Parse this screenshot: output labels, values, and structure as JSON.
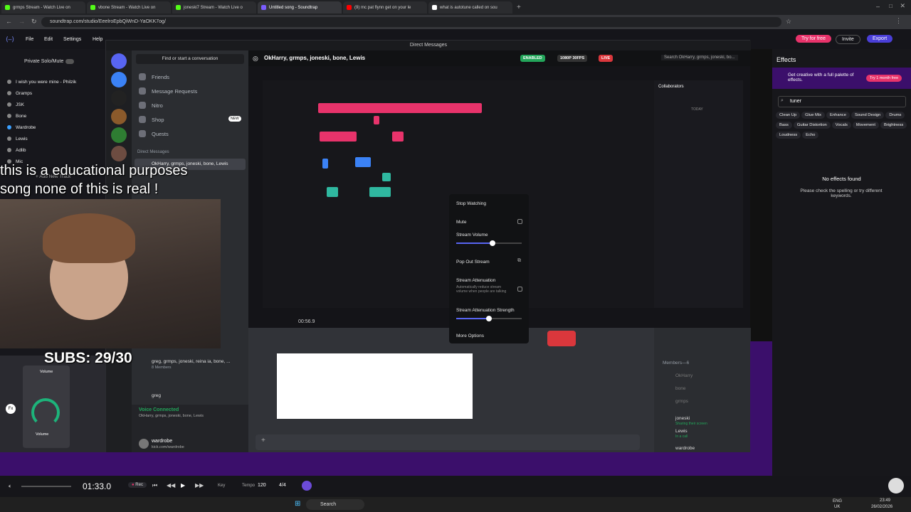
{
  "browser": {
    "tabs": [
      {
        "label": "grmps Stream - Watch Live on",
        "color": "#53fc18"
      },
      {
        "label": "vbone Stream - Watch Live on",
        "color": "#53fc18"
      },
      {
        "label": "joneski7 Stream - Watch Live o",
        "color": "#53fc18"
      },
      {
        "label": "Untitled song - Soundtrap",
        "color": "#7a5cff"
      },
      {
        "label": "(9) mc pat flynn get on your le",
        "color": "#ff0000"
      },
      {
        "label": "what is autotune called on sou",
        "color": "#ffffff"
      }
    ],
    "url": "soundtrap.com/studio/EeelroEpbQiWnD-YaOKK7og/"
  },
  "soundtrap": {
    "menu": [
      "File",
      "Edit",
      "Settings",
      "Help"
    ],
    "private_solo": "Private Solo/Mute",
    "try_free": "Try for free",
    "invite": "Invite",
    "export": "Export",
    "tracks": [
      "I wish you were mine - Philzik",
      "Gramps",
      "JSK",
      "Bone",
      "Wardrobe",
      "Lewis",
      "Adlib",
      "Mic"
    ],
    "add_track": "+ Add New Track",
    "effects_title": "Effects",
    "effects_promo": "Get creative with a full palette of effects.",
    "try_month": "Try 1 month free",
    "search_value": "tuner",
    "effect_chips": [
      "Clean Up",
      "Glue Mix",
      "Enhance",
      "Sound Design",
      "Drums",
      "Bass",
      "Guitar Distortion",
      "Vocals",
      "Movement",
      "Brightness",
      "Loudness",
      "Echo"
    ],
    "no_effects": "No effects found",
    "no_effects_hint": "Please check the spelling or try different keywords.",
    "time": "01:33.0",
    "rec": "Rec",
    "key": "Key",
    "tempo_label": "Tempo",
    "tempo": "120",
    "signature": "4/4"
  },
  "discord": {
    "window_title": "Direct Messages",
    "search_placeholder": "Find or start a conversation",
    "nav": [
      "Friends",
      "Message Requests",
      "Nitro",
      "Shop",
      "Quests"
    ],
    "shop_badge": "NEW",
    "dm_header": "Direct Messages",
    "dm_item": "OkHarry, grmps, joneski, bone, Lewis",
    "dm_item_2": "greg, grmps, joneski, reina ia, bone, ...",
    "dm_item_2_sub": "8 Members",
    "dm_item_3": "greg",
    "call_title": "OkHarry, grmps, joneski, bone, Lewis",
    "enabled_badge": "ENABLED",
    "quality_badge": "1080P 30FPS",
    "live_badge": "LIVE",
    "header_search": "Search OkHarry, grmps, joneski, bo...",
    "voice_status": "Voice Connected",
    "voice_channel": "OkHarry, grmps, joneski, bone, Lewis",
    "user_name": "wardrobe",
    "user_status": "kick.com/wardrobe",
    "members_header": "Members—6",
    "members": [
      {
        "name": "OkHarry",
        "status": ""
      },
      {
        "name": "bone",
        "status": ""
      },
      {
        "name": "grmps",
        "status": ""
      },
      {
        "name": "joneski",
        "status": "Sharing their screen"
      },
      {
        "name": "Lewis",
        "status": "In a call"
      },
      {
        "name": "wardrobe",
        "status": ""
      }
    ],
    "context_menu": {
      "stop_watching": "Stop Watching",
      "mute": "Mute",
      "stream_volume": "Stream Volume",
      "stream_volume_level": 0.55,
      "pop_out": "Pop Out Stream",
      "attenuation": "Stream Attenuation",
      "attenuation_desc": "Automatically reduce stream volume when people are talking",
      "attenuation_strength": "Stream Attenuation Strength",
      "attenuation_strength_level": 0.5,
      "more_options": "More Options"
    },
    "stream_time": "00:56.9"
  },
  "overlay": {
    "caption_1": "this is a educational purposes",
    "caption_2": "song none of this is real !",
    "subs": "SUBS: 29/30",
    "volume_label": "Volume"
  },
  "collaborators": {
    "title": "Collaborators",
    "today": "TODAY"
  },
  "taskbar": {
    "search": "Search",
    "lang": "ENG",
    "region": "UK",
    "clock": "23:49",
    "date": "26/02/2026"
  }
}
